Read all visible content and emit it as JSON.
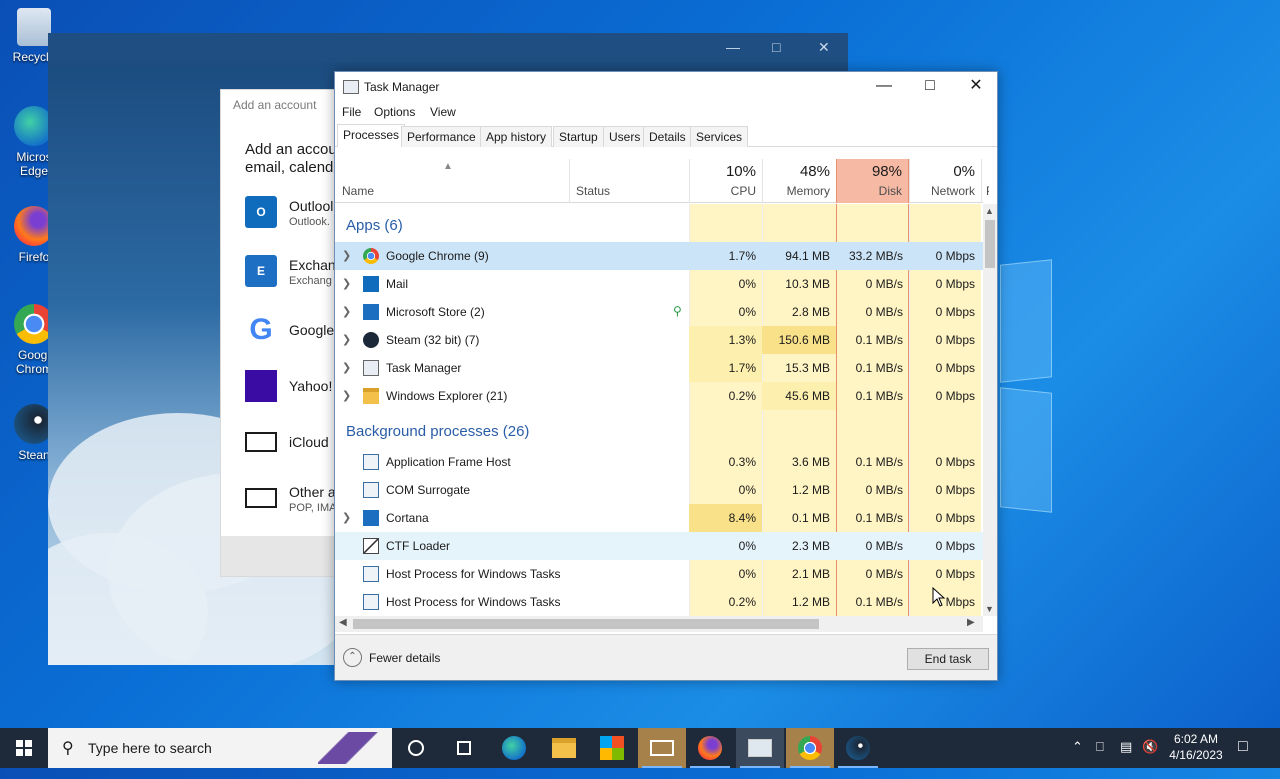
{
  "desktop": {
    "icons": [
      {
        "label": "Recycle",
        "icon": "recycle-bin-icon"
      },
      {
        "label": "Micros Edge",
        "icon": "edge-icon"
      },
      {
        "label": "Firefo",
        "icon": "firefox-icon"
      },
      {
        "label": "Googl Chrom",
        "icon": "chrome-icon"
      },
      {
        "label": "Stean",
        "icon": "steam-icon"
      }
    ]
  },
  "background_window": {
    "title": "Add an account",
    "heading_line1": "Add an accoun",
    "heading_line2": "email, calenda",
    "accounts": [
      {
        "name": "Outlool",
        "sub": "Outlook.",
        "icon": "outlook-icon"
      },
      {
        "name": "Exchang",
        "sub": "Exchang",
        "icon": "exchange-icon"
      },
      {
        "name": "Google",
        "sub": "",
        "icon": "google-icon"
      },
      {
        "name": "Yahoo!",
        "sub": "",
        "icon": "yahoo-icon"
      },
      {
        "name": "iCloud",
        "sub": "",
        "icon": "mail-icon"
      },
      {
        "name": "Other a",
        "sub": "POP, IMA",
        "icon": "mail-icon"
      }
    ]
  },
  "task_manager": {
    "title": "Task Manager",
    "menu": [
      "File",
      "Options",
      "View"
    ],
    "tabs": [
      "Processes",
      "Performance",
      "App history",
      "Startup",
      "Users",
      "Details",
      "Services"
    ],
    "active_tab": "Processes",
    "columns": {
      "name": "Name",
      "status": "Status",
      "cpu": {
        "pct": "10%",
        "label": "CPU"
      },
      "memory": {
        "pct": "48%",
        "label": "Memory"
      },
      "disk": {
        "pct": "98%",
        "label": "Disk"
      },
      "network": {
        "pct": "0%",
        "label": "Network"
      },
      "power_partial": "P"
    },
    "groups": {
      "apps": "Apps (6)",
      "background": "Background processes (26)"
    },
    "apps": [
      {
        "name": "Google Chrome (9)",
        "cpu": "1.7%",
        "memory": "94.1 MB",
        "disk": "33.2 MB/s",
        "network": "0 Mbps",
        "icon": "chrome-icon",
        "expandable": true
      },
      {
        "name": "Mail",
        "cpu": "0%",
        "memory": "10.3 MB",
        "disk": "0 MB/s",
        "network": "0 Mbps",
        "icon": "mail-app-icon",
        "expandable": true
      },
      {
        "name": "Microsoft Store (2)",
        "cpu": "0%",
        "memory": "2.8 MB",
        "disk": "0 MB/s",
        "network": "0 Mbps",
        "icon": "store-icon",
        "expandable": true
      },
      {
        "name": "Steam (32 bit) (7)",
        "cpu": "1.3%",
        "memory": "150.6 MB",
        "disk": "0.1 MB/s",
        "network": "0 Mbps",
        "icon": "steam-icon",
        "expandable": true
      },
      {
        "name": "Task Manager",
        "cpu": "1.7%",
        "memory": "15.3 MB",
        "disk": "0.1 MB/s",
        "network": "0 Mbps",
        "icon": "task-manager-icon",
        "expandable": true
      },
      {
        "name": "Windows Explorer (21)",
        "cpu": "0.2%",
        "memory": "45.6 MB",
        "disk": "0.1 MB/s",
        "network": "0 Mbps",
        "icon": "folder-icon",
        "expandable": true
      }
    ],
    "background": [
      {
        "name": "Application Frame Host",
        "cpu": "0.3%",
        "memory": "3.6 MB",
        "disk": "0.1 MB/s",
        "network": "0 Mbps",
        "icon": "app-frame-icon",
        "expandable": false
      },
      {
        "name": "COM Surrogate",
        "cpu": "0%",
        "memory": "1.2 MB",
        "disk": "0 MB/s",
        "network": "0 Mbps",
        "icon": "app-frame-icon",
        "expandable": false
      },
      {
        "name": "Cortana",
        "cpu": "8.4%",
        "memory": "0.1 MB",
        "disk": "0.1 MB/s",
        "network": "0 Mbps",
        "icon": "cortana-icon",
        "expandable": true
      },
      {
        "name": "CTF Loader",
        "cpu": "0%",
        "memory": "2.3 MB",
        "disk": "0 MB/s",
        "network": "0 Mbps",
        "icon": "ctf-loader-icon",
        "expandable": false
      },
      {
        "name": "Host Process for Windows Tasks",
        "cpu": "0%",
        "memory": "2.1 MB",
        "disk": "0 MB/s",
        "network": "0 Mbps",
        "icon": "app-frame-icon",
        "expandable": false
      },
      {
        "name": "Host Process for Windows Tasks",
        "cpu": "0.2%",
        "memory": "1.2 MB",
        "disk": "0.1 MB/s",
        "network": "Mbps",
        "icon": "app-frame-icon",
        "expandable": false
      }
    ],
    "fewer_details": "Fewer details",
    "end_task": "End task"
  },
  "taskbar": {
    "search_placeholder": "Type here to search",
    "pinned": [
      "cortana-icon",
      "task-view-icon",
      "edge-icon",
      "file-explorer-icon",
      "store-icon",
      "mail-icon",
      "firefox-icon",
      "task-manager-icon",
      "chrome-icon",
      "steam-icon"
    ],
    "time": "6:02 AM",
    "date": "4/16/2023"
  },
  "colors": {
    "accent_blue": "#2a5da8",
    "disk_header": "#f6b9a3",
    "heat_low": "#fff4c4",
    "heat_mid": "#fdefad",
    "heat_high": "#f9e18a",
    "selection": "#cce4f7"
  }
}
